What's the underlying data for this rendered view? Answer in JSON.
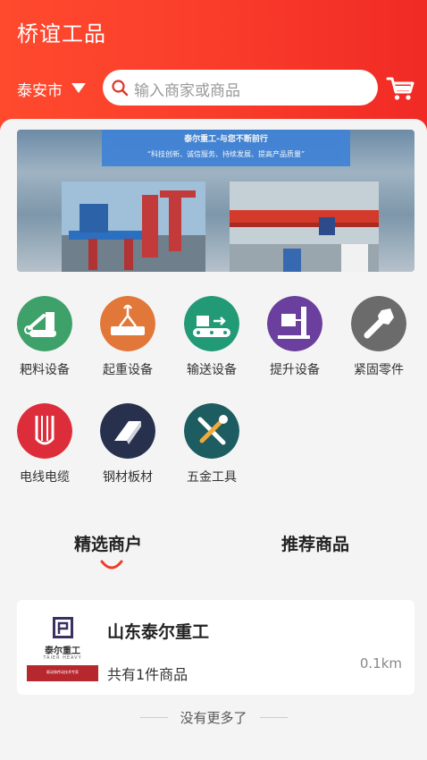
{
  "header": {
    "title": "桥谊工品",
    "city": "泰安市",
    "search_placeholder": "输入商家或商品"
  },
  "banner": {
    "title": "泰尔重工-与您不断前行",
    "slogan": "“科技创新、诚信服务、持续发展、提高产品质量”"
  },
  "categories": [
    {
      "label": "耙料设备",
      "color": "#3fa16a",
      "icon": "stacker-reclaimer-icon"
    },
    {
      "label": "起重设备",
      "color": "#e2773a",
      "icon": "hoist-icon"
    },
    {
      "label": "输送设备",
      "color": "#239a76",
      "icon": "conveyor-icon"
    },
    {
      "label": "提升设备",
      "color": "#6a3f9d",
      "icon": "elevator-icon"
    },
    {
      "label": "紧固零件",
      "color": "#6b6b6b",
      "icon": "bolt-icon"
    },
    {
      "label": "电线电缆",
      "color": "#dd2d3b",
      "icon": "cable-icon"
    },
    {
      "label": "钢材板材",
      "color": "#27314e",
      "icon": "steel-beam-icon"
    },
    {
      "label": "五金工具",
      "color": "#1d5c60",
      "icon": "tools-icon"
    }
  ],
  "tabs": [
    {
      "label": "精选商户",
      "active": true
    },
    {
      "label": "推荐商品",
      "active": false
    }
  ],
  "merchant": {
    "logo_text": "泰尔重工",
    "logo_sub": "TAIER HEAVY",
    "logo_bar_text": "驱动和传动技术专家",
    "name": "山东泰尔重工",
    "count": "共有1件商品",
    "distance": "0.1km"
  },
  "footer": {
    "no_more": "没有更多了"
  },
  "colors": {
    "brand_red": "#f93b2a",
    "accent_orange": "#ff4a2e"
  }
}
